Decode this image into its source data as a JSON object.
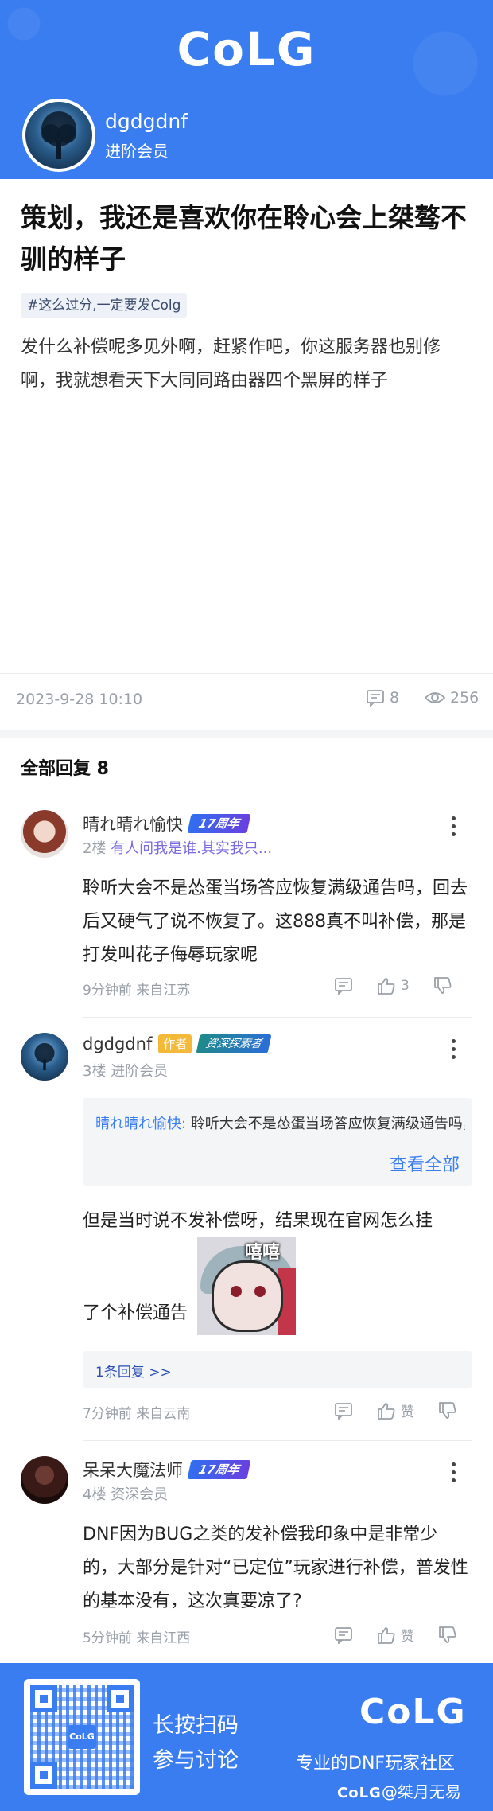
{
  "header": {
    "logo": "CoLG",
    "user_name": "dgdgdnf",
    "user_level": "进阶会员",
    "avatar_icon": "tree-avatar-icon"
  },
  "post": {
    "title": "策划，我还是喜欢你在聆心会上桀骜不驯的样子",
    "tag": "#这么过分,一定要发Colg",
    "body": "发什么补偿呢多见外啊，赶紧作吧，你这服务器也别修啊，我就想看天下大同同路由器四个黑屏的样子",
    "date": "2023-9-28 10:10",
    "comments": "8",
    "views": "256"
  },
  "replies_header": "全部回复 8",
  "replies": [
    {
      "name": "晴れ晴れ愉快",
      "badge": "17周年",
      "floor": "2楼",
      "signature": "有人问我是谁.其实我只...",
      "text": "聆听大会不是怂蛋当场答应恢复满级通告吗，回去后又硬气了说不恢复了。这888真不叫补偿，那是打发叫花子侮辱玩家呢",
      "meta": "9分钟前 来自江苏",
      "likes": "3"
    },
    {
      "name": "dgdgdnf",
      "author_badge": "作者",
      "badge": "资深探索者",
      "floor": "3楼",
      "level": "进阶会员",
      "quote_name": "晴れ晴れ愉快:",
      "quote_text": "聆听大会不是怂蛋当场答应恢复满级通告吗，回去后又硬气了说不恢复了。",
      "quote_all": "查看全部",
      "text_line1": "但是当时说不发补偿呀，结果现在官网怎么挂",
      "text_line2": "了个补偿通告",
      "sticker_text": "嘻嘻",
      "sub_reply": "1条回复 >>",
      "meta": "7分钟前 来自云南",
      "likes": "赞"
    },
    {
      "name": "呆呆大魔法师",
      "badge": "17周年",
      "floor": "4楼",
      "level": "资深会员",
      "text": "DNF因为BUG之类的发补偿我印象中是非常少的，大部分是针对“已定位”玩家进行补偿，普发性的基本没有，这次真要凉了?",
      "meta": "5分钟前 来自江西",
      "likes": "赞"
    }
  ],
  "footer": {
    "qr_label": "CoLG",
    "line1": "长按扫码",
    "line2": "参与讨论",
    "logo": "CoLG",
    "slogan": "专业的DNF玩家社区",
    "credit_logo": "CoLG",
    "credit_user": "@桀月无易"
  },
  "colors": {
    "brand": "#3a7df0",
    "muted": "#9aa0a8",
    "link": "#3a7df0"
  }
}
